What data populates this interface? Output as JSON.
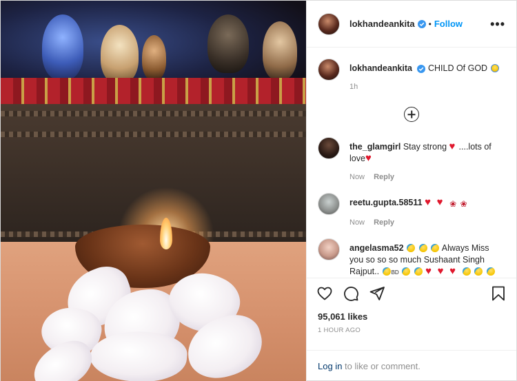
{
  "post": {
    "username": "lokhandeankita",
    "follow_label": "Follow",
    "more_label": "•••",
    "separator": "•"
  },
  "caption": {
    "username": "lokhandeankita",
    "text": "CHILD Of GOD",
    "time": "1h"
  },
  "comments": [
    {
      "username": "the_glamgirl",
      "text_a": "Stay strong",
      "text_b": "....lots of love",
      "time": "Now",
      "reply_label": "Reply"
    },
    {
      "username": "reetu.gupta.58511",
      "time": "Now",
      "reply_label": "Reply"
    },
    {
      "username": "angelasma52",
      "text_a": "Always Miss you so so so much Sushaant Singh Rajput..",
      "text_b": "BD"
    }
  ],
  "actions": {
    "like_icon": "heart-icon",
    "comment_icon": "comment-icon",
    "share_icon": "paper-plane-icon",
    "save_icon": "bookmark-icon"
  },
  "likes_text": "95,061 likes",
  "timestamp": "1 HOUR AGO",
  "login": {
    "link_label": "Log in",
    "rest": "to like or comment."
  },
  "colors": {
    "accent": "#0095f6",
    "muted": "#8e8e8e",
    "heart": "#e0182d",
    "link_dark": "#00376b"
  }
}
